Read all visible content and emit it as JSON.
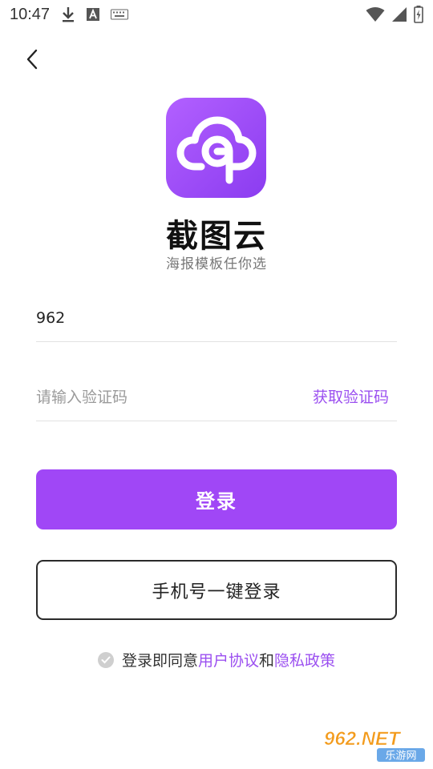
{
  "status_bar": {
    "time": "10:47",
    "left_icons": [
      "download-icon",
      "text-a-icon",
      "keyboard-icon"
    ],
    "right_icons": [
      "wifi-icon",
      "cellular-icon",
      "battery-icon"
    ]
  },
  "nav": {
    "back_icon": "chevron-left-icon"
  },
  "brand": {
    "name": "截图云",
    "slogan": "海报模板任你选",
    "logo_icon": "cloud-logo-icon",
    "logo_colors": [
      "#b260ff",
      "#8b3cf0"
    ]
  },
  "form": {
    "phone_value": "962",
    "code_placeholder": "请输入验证码",
    "get_code_label": "获取验证码"
  },
  "buttons": {
    "login_label": "登录",
    "onekey_label": "手机号一键登录"
  },
  "agreement": {
    "prefix": "登录即同意",
    "user_agreement": "用户协议",
    "and": "和",
    "privacy_policy": "隐私政策"
  },
  "watermark": {
    "text_top": "962.NET",
    "text_bottom": "乐游网"
  },
  "colors": {
    "accent": "#a047f6",
    "link": "#9b4ff0"
  }
}
